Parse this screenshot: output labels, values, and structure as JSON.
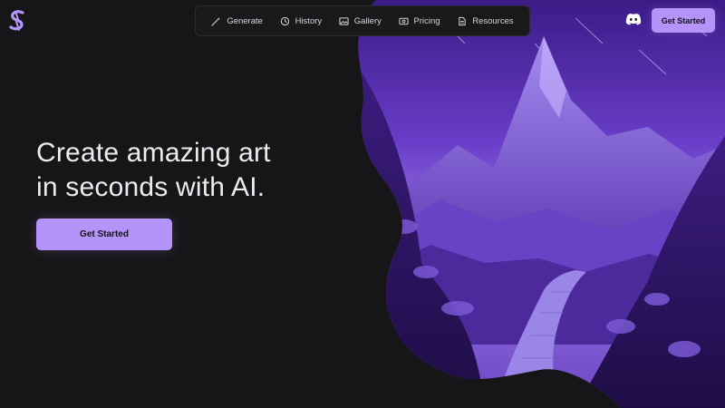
{
  "brand": {
    "logo_icon": "s-logo-icon",
    "accent": "#b494f8"
  },
  "nav": {
    "items": [
      {
        "label": "Generate",
        "icon": "magic-wand-icon"
      },
      {
        "label": "History",
        "icon": "history-icon"
      },
      {
        "label": "Gallery",
        "icon": "image-icon"
      },
      {
        "label": "Pricing",
        "icon": "pricing-icon"
      },
      {
        "label": "Resources",
        "icon": "resources-icon"
      }
    ]
  },
  "header": {
    "discord_icon": "discord-icon",
    "cta_label": "Get Started"
  },
  "hero": {
    "title_line1": "Create amazing art",
    "title_line2": "in seconds with AI.",
    "cta_label": "Get Started"
  },
  "artwork": {
    "subject": "purple-mountain-landscape-image"
  }
}
